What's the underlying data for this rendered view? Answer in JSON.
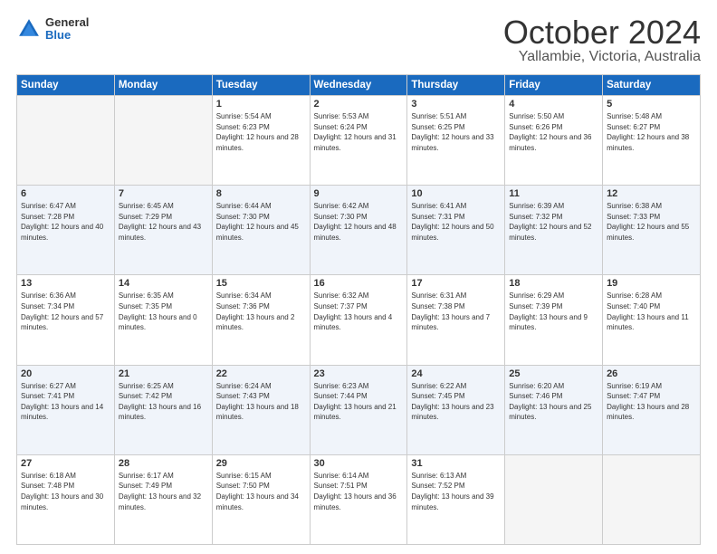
{
  "header": {
    "title": "October 2024",
    "subtitle": "Yallambie, Victoria, Australia",
    "logo_general": "General",
    "logo_blue": "Blue"
  },
  "weekdays": [
    "Sunday",
    "Monday",
    "Tuesday",
    "Wednesday",
    "Thursday",
    "Friday",
    "Saturday"
  ],
  "weeks": [
    [
      {
        "day": "",
        "empty": true
      },
      {
        "day": "",
        "empty": true
      },
      {
        "day": "1",
        "sunrise": "Sunrise: 5:54 AM",
        "sunset": "Sunset: 6:23 PM",
        "daylight": "Daylight: 12 hours and 28 minutes."
      },
      {
        "day": "2",
        "sunrise": "Sunrise: 5:53 AM",
        "sunset": "Sunset: 6:24 PM",
        "daylight": "Daylight: 12 hours and 31 minutes."
      },
      {
        "day": "3",
        "sunrise": "Sunrise: 5:51 AM",
        "sunset": "Sunset: 6:25 PM",
        "daylight": "Daylight: 12 hours and 33 minutes."
      },
      {
        "day": "4",
        "sunrise": "Sunrise: 5:50 AM",
        "sunset": "Sunset: 6:26 PM",
        "daylight": "Daylight: 12 hours and 36 minutes."
      },
      {
        "day": "5",
        "sunrise": "Sunrise: 5:48 AM",
        "sunset": "Sunset: 6:27 PM",
        "daylight": "Daylight: 12 hours and 38 minutes."
      }
    ],
    [
      {
        "day": "6",
        "sunrise": "Sunrise: 6:47 AM",
        "sunset": "Sunset: 7:28 PM",
        "daylight": "Daylight: 12 hours and 40 minutes."
      },
      {
        "day": "7",
        "sunrise": "Sunrise: 6:45 AM",
        "sunset": "Sunset: 7:29 PM",
        "daylight": "Daylight: 12 hours and 43 minutes."
      },
      {
        "day": "8",
        "sunrise": "Sunrise: 6:44 AM",
        "sunset": "Sunset: 7:30 PM",
        "daylight": "Daylight: 12 hours and 45 minutes."
      },
      {
        "day": "9",
        "sunrise": "Sunrise: 6:42 AM",
        "sunset": "Sunset: 7:30 PM",
        "daylight": "Daylight: 12 hours and 48 minutes."
      },
      {
        "day": "10",
        "sunrise": "Sunrise: 6:41 AM",
        "sunset": "Sunset: 7:31 PM",
        "daylight": "Daylight: 12 hours and 50 minutes."
      },
      {
        "day": "11",
        "sunrise": "Sunrise: 6:39 AM",
        "sunset": "Sunset: 7:32 PM",
        "daylight": "Daylight: 12 hours and 52 minutes."
      },
      {
        "day": "12",
        "sunrise": "Sunrise: 6:38 AM",
        "sunset": "Sunset: 7:33 PM",
        "daylight": "Daylight: 12 hours and 55 minutes."
      }
    ],
    [
      {
        "day": "13",
        "sunrise": "Sunrise: 6:36 AM",
        "sunset": "Sunset: 7:34 PM",
        "daylight": "Daylight: 12 hours and 57 minutes."
      },
      {
        "day": "14",
        "sunrise": "Sunrise: 6:35 AM",
        "sunset": "Sunset: 7:35 PM",
        "daylight": "Daylight: 13 hours and 0 minutes."
      },
      {
        "day": "15",
        "sunrise": "Sunrise: 6:34 AM",
        "sunset": "Sunset: 7:36 PM",
        "daylight": "Daylight: 13 hours and 2 minutes."
      },
      {
        "day": "16",
        "sunrise": "Sunrise: 6:32 AM",
        "sunset": "Sunset: 7:37 PM",
        "daylight": "Daylight: 13 hours and 4 minutes."
      },
      {
        "day": "17",
        "sunrise": "Sunrise: 6:31 AM",
        "sunset": "Sunset: 7:38 PM",
        "daylight": "Daylight: 13 hours and 7 minutes."
      },
      {
        "day": "18",
        "sunrise": "Sunrise: 6:29 AM",
        "sunset": "Sunset: 7:39 PM",
        "daylight": "Daylight: 13 hours and 9 minutes."
      },
      {
        "day": "19",
        "sunrise": "Sunrise: 6:28 AM",
        "sunset": "Sunset: 7:40 PM",
        "daylight": "Daylight: 13 hours and 11 minutes."
      }
    ],
    [
      {
        "day": "20",
        "sunrise": "Sunrise: 6:27 AM",
        "sunset": "Sunset: 7:41 PM",
        "daylight": "Daylight: 13 hours and 14 minutes."
      },
      {
        "day": "21",
        "sunrise": "Sunrise: 6:25 AM",
        "sunset": "Sunset: 7:42 PM",
        "daylight": "Daylight: 13 hours and 16 minutes."
      },
      {
        "day": "22",
        "sunrise": "Sunrise: 6:24 AM",
        "sunset": "Sunset: 7:43 PM",
        "daylight": "Daylight: 13 hours and 18 minutes."
      },
      {
        "day": "23",
        "sunrise": "Sunrise: 6:23 AM",
        "sunset": "Sunset: 7:44 PM",
        "daylight": "Daylight: 13 hours and 21 minutes."
      },
      {
        "day": "24",
        "sunrise": "Sunrise: 6:22 AM",
        "sunset": "Sunset: 7:45 PM",
        "daylight": "Daylight: 13 hours and 23 minutes."
      },
      {
        "day": "25",
        "sunrise": "Sunrise: 6:20 AM",
        "sunset": "Sunset: 7:46 PM",
        "daylight": "Daylight: 13 hours and 25 minutes."
      },
      {
        "day": "26",
        "sunrise": "Sunrise: 6:19 AM",
        "sunset": "Sunset: 7:47 PM",
        "daylight": "Daylight: 13 hours and 28 minutes."
      }
    ],
    [
      {
        "day": "27",
        "sunrise": "Sunrise: 6:18 AM",
        "sunset": "Sunset: 7:48 PM",
        "daylight": "Daylight: 13 hours and 30 minutes."
      },
      {
        "day": "28",
        "sunrise": "Sunrise: 6:17 AM",
        "sunset": "Sunset: 7:49 PM",
        "daylight": "Daylight: 13 hours and 32 minutes."
      },
      {
        "day": "29",
        "sunrise": "Sunrise: 6:15 AM",
        "sunset": "Sunset: 7:50 PM",
        "daylight": "Daylight: 13 hours and 34 minutes."
      },
      {
        "day": "30",
        "sunrise": "Sunrise: 6:14 AM",
        "sunset": "Sunset: 7:51 PM",
        "daylight": "Daylight: 13 hours and 36 minutes."
      },
      {
        "day": "31",
        "sunrise": "Sunrise: 6:13 AM",
        "sunset": "Sunset: 7:52 PM",
        "daylight": "Daylight: 13 hours and 39 minutes."
      },
      {
        "day": "",
        "empty": true
      },
      {
        "day": "",
        "empty": true
      }
    ]
  ]
}
